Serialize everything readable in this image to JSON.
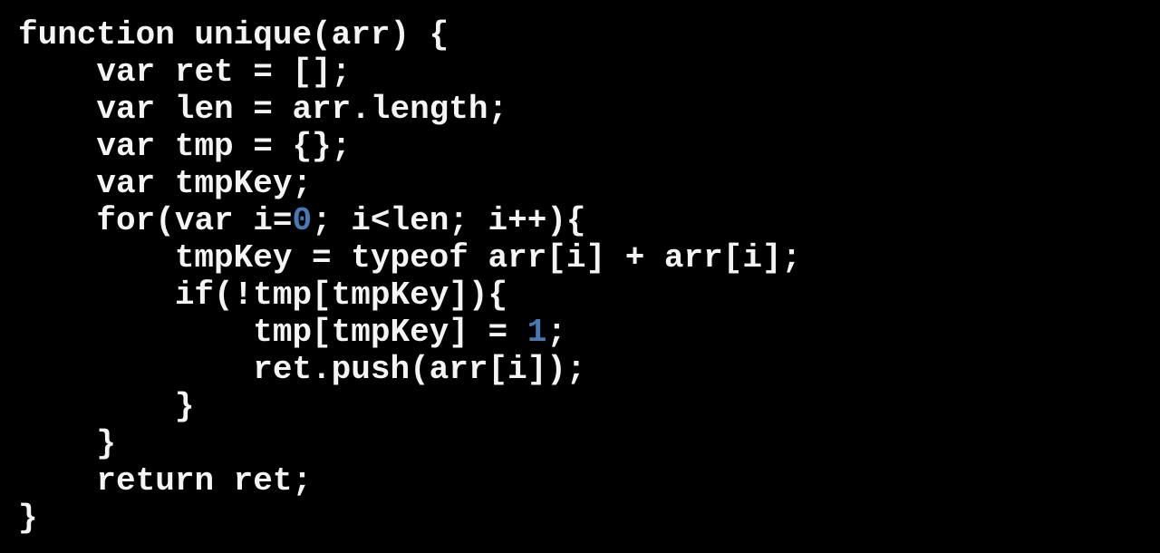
{
  "code": {
    "language": "javascript",
    "number_color": "#4a78b0",
    "text_color": "#f4f4f4",
    "background": "#000000",
    "lines": [
      {
        "indent": 0,
        "parts": [
          {
            "t": "function unique(arr) {"
          }
        ]
      },
      {
        "indent": 1,
        "parts": [
          {
            "t": "var ret = [];"
          }
        ]
      },
      {
        "indent": 1,
        "parts": [
          {
            "t": "var len = arr.length;"
          }
        ]
      },
      {
        "indent": 1,
        "parts": [
          {
            "t": "var tmp = {};"
          }
        ]
      },
      {
        "indent": 1,
        "parts": [
          {
            "t": "var tmpKey;"
          }
        ]
      },
      {
        "indent": 1,
        "parts": [
          {
            "t": "for(var i="
          },
          {
            "t": "0",
            "num": true
          },
          {
            "t": "; i<len; i++){"
          }
        ]
      },
      {
        "indent": 2,
        "parts": [
          {
            "t": "tmpKey = typeof arr[i] + arr[i];"
          }
        ]
      },
      {
        "indent": 2,
        "parts": [
          {
            "t": "if(!tmp[tmpKey]){"
          }
        ]
      },
      {
        "indent": 3,
        "parts": [
          {
            "t": "tmp[tmpKey] = "
          },
          {
            "t": "1",
            "num": true
          },
          {
            "t": ";"
          }
        ]
      },
      {
        "indent": 3,
        "parts": [
          {
            "t": "ret.push(arr[i]);"
          }
        ]
      },
      {
        "indent": 2,
        "parts": [
          {
            "t": "}"
          }
        ]
      },
      {
        "indent": 1,
        "parts": [
          {
            "t": "}"
          }
        ]
      },
      {
        "indent": 1,
        "parts": [
          {
            "t": "return ret;"
          }
        ]
      },
      {
        "indent": 0,
        "parts": [
          {
            "t": "}"
          }
        ]
      }
    ]
  }
}
